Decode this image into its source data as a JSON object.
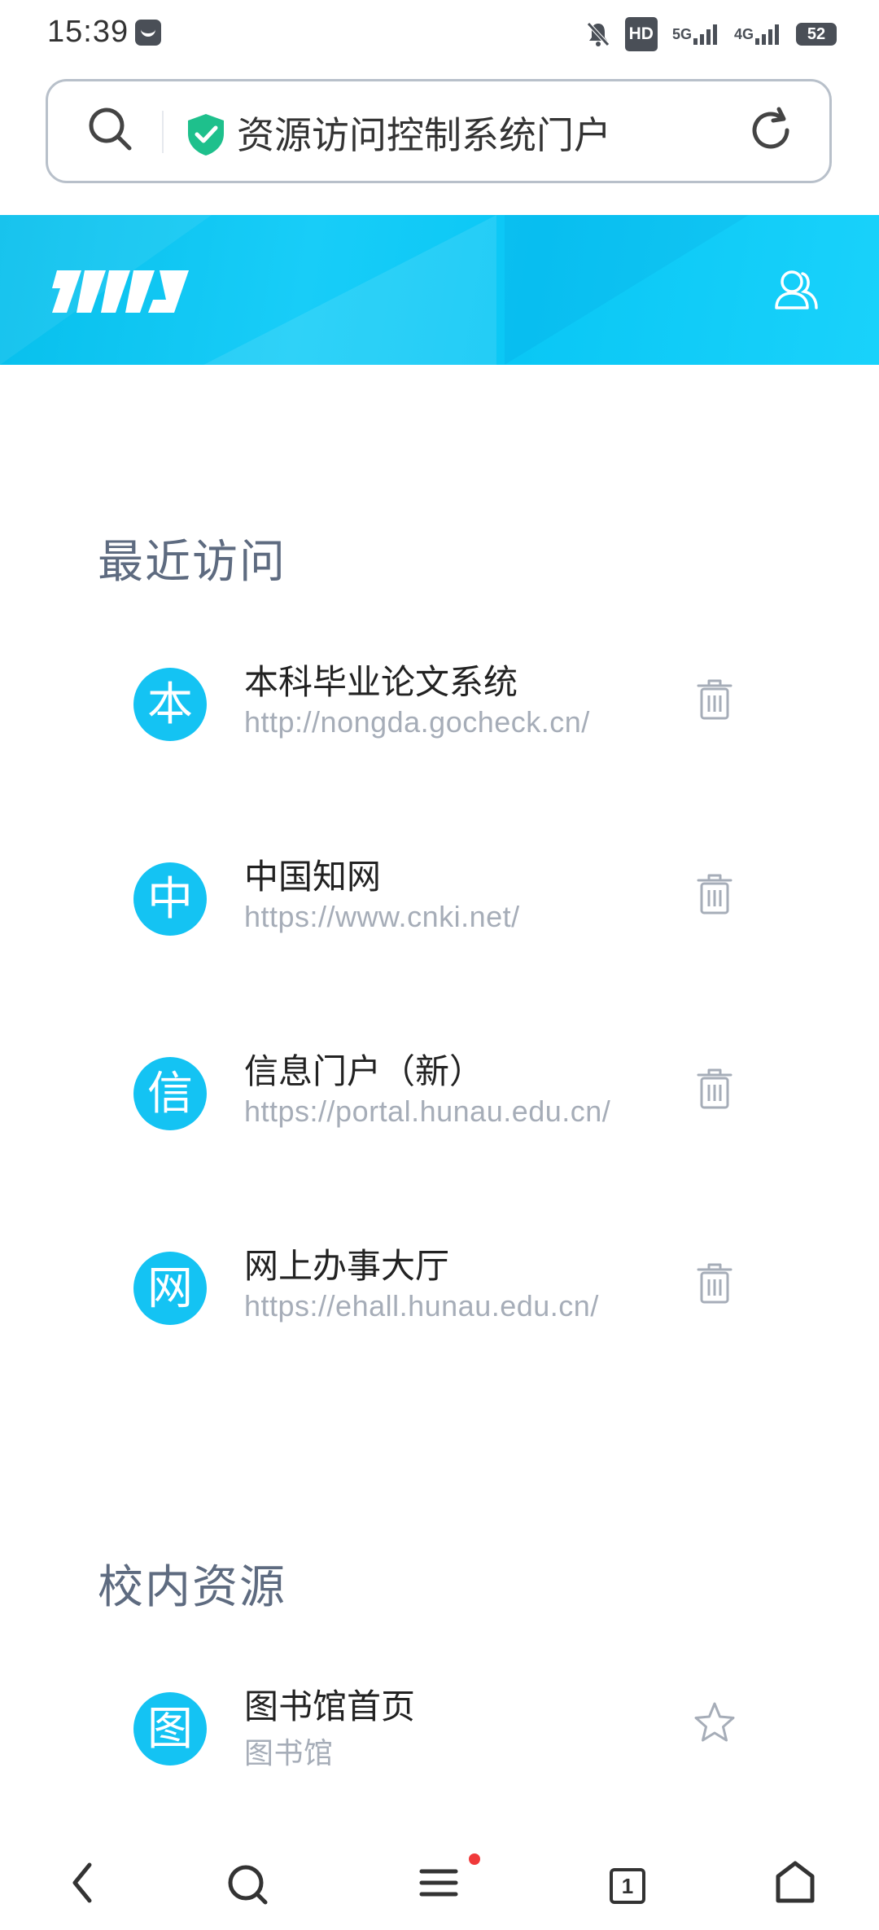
{
  "status_bar": {
    "time": "15:39",
    "hd_label": "HD",
    "net_5g": "5G",
    "net_4g": "4G",
    "battery": "52"
  },
  "address_bar": {
    "title": "资源访问控制系统门户",
    "secure_color": "#1ec08c"
  },
  "banner": {
    "logo_text": "TMI",
    "accent": "#14c3f3"
  },
  "sections": {
    "recent_title": "最近访问",
    "campus_title": "校内资源"
  },
  "recent_items": [
    {
      "avatar": "本",
      "title": "本科毕业论文系统",
      "url": "http://nongda.gocheck.cn/"
    },
    {
      "avatar": "中",
      "title": "中国知网",
      "url": "https://www.cnki.net/"
    },
    {
      "avatar": "信",
      "title": "信息门户（新）",
      "url": "https://portal.hunau.edu.cn/"
    },
    {
      "avatar": "网",
      "title": "网上办事大厅",
      "url": "https://ehall.hunau.edu.cn/"
    }
  ],
  "campus_items": [
    {
      "avatar": "图",
      "title": "图书馆首页",
      "subtitle": "图书馆"
    }
  ],
  "bottom_nav": {
    "tab_count": "1"
  }
}
